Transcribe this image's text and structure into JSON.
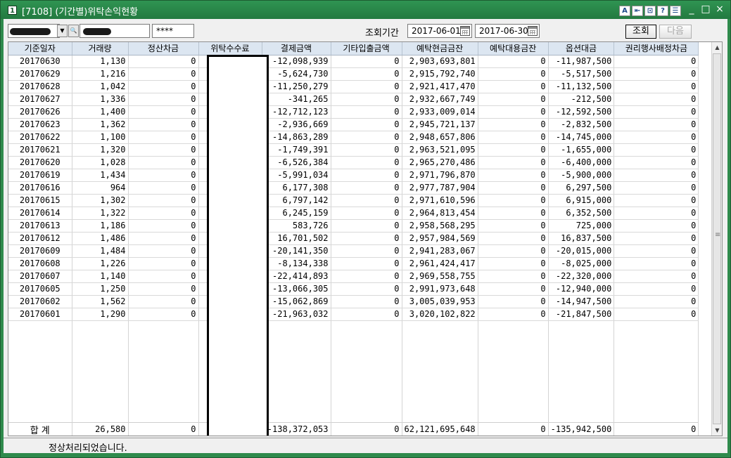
{
  "window": {
    "badge": "1",
    "title": "[7108] (기간별)위탁손익현황",
    "toolbar_icons": [
      "A",
      "⇤",
      "⊡",
      "?",
      "☰"
    ],
    "controls": [
      "_",
      "□",
      "×"
    ]
  },
  "toolbar": {
    "password_value": "****",
    "period_label": "조회기간",
    "date_from": "2017-06-01",
    "date_to": "2017-06-30",
    "search_button": "조회",
    "next_button": "다음"
  },
  "table": {
    "headers": [
      "기준일자",
      "거래량",
      "정산차금",
      "위탁수수료",
      "결제금액",
      "기타입출금액",
      "예탁현금금잔",
      "예탁대용금잔",
      "옵션대금",
      "권리행사배정차금"
    ],
    "rows": [
      [
        "20170630",
        "1,130",
        "0",
        "",
        "-12,098,939",
        "0",
        "2,903,693,801",
        "0",
        "-11,987,500",
        "0"
      ],
      [
        "20170629",
        "1,216",
        "0",
        "",
        "-5,624,730",
        "0",
        "2,915,792,740",
        "0",
        "-5,517,500",
        "0"
      ],
      [
        "20170628",
        "1,042",
        "0",
        "",
        "-11,250,279",
        "0",
        "2,921,417,470",
        "0",
        "-11,132,500",
        "0"
      ],
      [
        "20170627",
        "1,336",
        "0",
        "",
        "-341,265",
        "0",
        "2,932,667,749",
        "0",
        "-212,500",
        "0"
      ],
      [
        "20170626",
        "1,400",
        "0",
        "",
        "-12,712,123",
        "0",
        "2,933,009,014",
        "0",
        "-12,592,500",
        "0"
      ],
      [
        "20170623",
        "1,362",
        "0",
        "",
        "-2,936,669",
        "0",
        "2,945,721,137",
        "0",
        "-2,832,500",
        "0"
      ],
      [
        "20170622",
        "1,100",
        "0",
        "",
        "-14,863,289",
        "0",
        "2,948,657,806",
        "0",
        "-14,745,000",
        "0"
      ],
      [
        "20170621",
        "1,320",
        "0",
        "",
        "-1,749,391",
        "0",
        "2,963,521,095",
        "0",
        "-1,655,000",
        "0"
      ],
      [
        "20170620",
        "1,028",
        "0",
        "",
        "-6,526,384",
        "0",
        "2,965,270,486",
        "0",
        "-6,400,000",
        "0"
      ],
      [
        "20170619",
        "1,434",
        "0",
        "",
        "-5,991,034",
        "0",
        "2,971,796,870",
        "0",
        "-5,900,000",
        "0"
      ],
      [
        "20170616",
        "964",
        "0",
        "",
        "6,177,308",
        "0",
        "2,977,787,904",
        "0",
        "6,297,500",
        "0"
      ],
      [
        "20170615",
        "1,302",
        "0",
        "",
        "6,797,142",
        "0",
        "2,971,610,596",
        "0",
        "6,915,000",
        "0"
      ],
      [
        "20170614",
        "1,322",
        "0",
        "",
        "6,245,159",
        "0",
        "2,964,813,454",
        "0",
        "6,352,500",
        "0"
      ],
      [
        "20170613",
        "1,186",
        "0",
        "",
        "583,726",
        "0",
        "2,958,568,295",
        "0",
        "725,000",
        "0"
      ],
      [
        "20170612",
        "1,486",
        "0",
        "",
        "16,701,502",
        "0",
        "2,957,984,569",
        "0",
        "16,837,500",
        "0"
      ],
      [
        "20170609",
        "1,484",
        "0",
        "",
        "-20,141,350",
        "0",
        "2,941,283,067",
        "0",
        "-20,015,000",
        "0"
      ],
      [
        "20170608",
        "1,226",
        "0",
        "",
        "-8,134,338",
        "0",
        "2,961,424,417",
        "0",
        "-8,025,000",
        "0"
      ],
      [
        "20170607",
        "1,140",
        "0",
        "",
        "-22,414,893",
        "0",
        "2,969,558,755",
        "0",
        "-22,320,000",
        "0"
      ],
      [
        "20170605",
        "1,250",
        "0",
        "",
        "-13,066,305",
        "0",
        "2,991,973,648",
        "0",
        "-12,940,000",
        "0"
      ],
      [
        "20170602",
        "1,562",
        "0",
        "",
        "-15,062,869",
        "0",
        "3,005,039,953",
        "0",
        "-14,947,500",
        "0"
      ],
      [
        "20170601",
        "1,290",
        "0",
        "",
        "-21,963,032",
        "0",
        "3,020,102,822",
        "0",
        "-21,847,500",
        "0"
      ]
    ],
    "total": [
      "합 계",
      "26,580",
      "0",
      "",
      "-138,372,053",
      "0",
      "62,121,695,648",
      "0",
      "-135,942,500",
      "0"
    ]
  },
  "status": {
    "message": "정상처리되었습니다."
  }
}
